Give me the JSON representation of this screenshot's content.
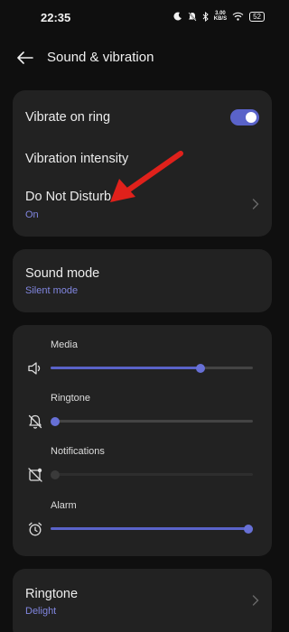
{
  "status_bar": {
    "time": "22:35",
    "net_speed_value": "3.00",
    "net_speed_unit": "KB/S",
    "battery": "52"
  },
  "header": {
    "title": "Sound & vibration",
    "back_icon": "arrow-left-icon"
  },
  "vibration_card": {
    "vibrate_on_ring": {
      "label": "Vibrate on ring",
      "enabled": true
    },
    "vibration_intensity": {
      "label": "Vibration intensity"
    },
    "do_not_disturb": {
      "label": "Do Not Disturb",
      "status": "On"
    }
  },
  "sound_mode_card": {
    "label": "Sound mode",
    "value": "Silent mode"
  },
  "volume_card": {
    "sliders": [
      {
        "label": "Media",
        "icon": "speaker-icon",
        "level": 0.74,
        "enabled": true
      },
      {
        "label": "Ringtone",
        "icon": "bell-off-icon",
        "level": 0.0,
        "enabled": true
      },
      {
        "label": "Notifications",
        "icon": "notification-off-icon",
        "level": 0.0,
        "enabled": false
      },
      {
        "label": "Alarm",
        "icon": "alarm-clock-icon",
        "level": 1.0,
        "enabled": true
      }
    ]
  },
  "ringtone_card": {
    "label": "Ringtone",
    "value": "Delight"
  },
  "colors": {
    "accent": "#5a63c9",
    "subtext_accent": "#8186e0",
    "card_bg": "#222222",
    "page_bg": "#0f0f0f",
    "annotation": "#e0211b"
  }
}
